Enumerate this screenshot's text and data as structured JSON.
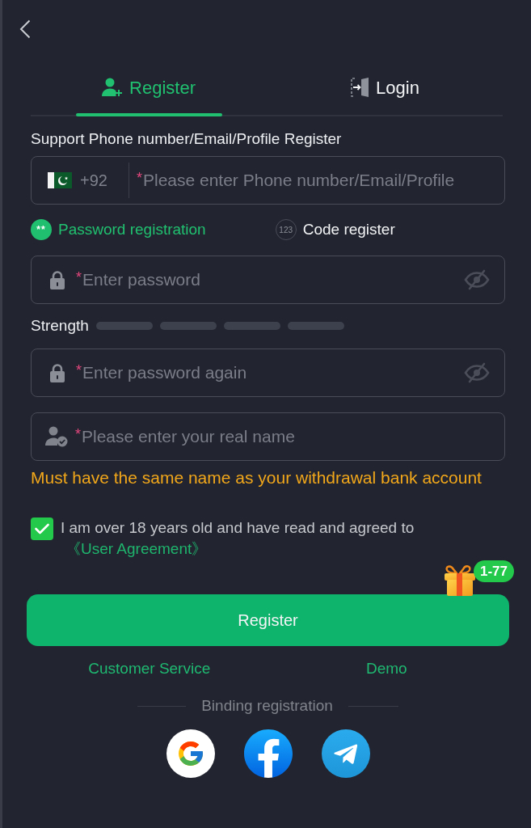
{
  "tabs": [
    {
      "kind": "register",
      "label": "Register",
      "selected": true
    },
    {
      "kind": "login",
      "label": "Login",
      "selected": false
    }
  ],
  "account": {
    "label": "Support Phone number/Email/Profile Register",
    "country_code": "+92",
    "required_mark": "*",
    "placeholder": "Please enter Phone number/Email/Profile"
  },
  "modes": [
    {
      "kind": "password",
      "badge": "**",
      "label": "Password registration",
      "selected": true
    },
    {
      "kind": "code",
      "badge": "123",
      "label": "Code register",
      "selected": false
    }
  ],
  "password": {
    "required_mark": "*",
    "placeholder": "Enter password"
  },
  "strength": {
    "label": "Strength",
    "segments": [
      {
        "active": false
      },
      {
        "active": false
      },
      {
        "active": false
      },
      {
        "active": false
      }
    ]
  },
  "password_again": {
    "required_mark": "*",
    "placeholder": "Enter password again"
  },
  "real_name": {
    "required_mark": "*",
    "placeholder": "Please enter your real name",
    "hint": "Must have the same name as your withdrawal bank account"
  },
  "agreement": {
    "checked": true,
    "text": "I am over 18 years old and have read and agreed to",
    "link": "《User Agreement》"
  },
  "register_button": {
    "label": "Register",
    "badge": "1-77"
  },
  "links": [
    "Customer Service",
    "Demo"
  ],
  "binding": {
    "label": "Binding registration",
    "providers": [
      {
        "kind": "google"
      },
      {
        "kind": "facebook"
      },
      {
        "kind": "telegram"
      }
    ]
  }
}
